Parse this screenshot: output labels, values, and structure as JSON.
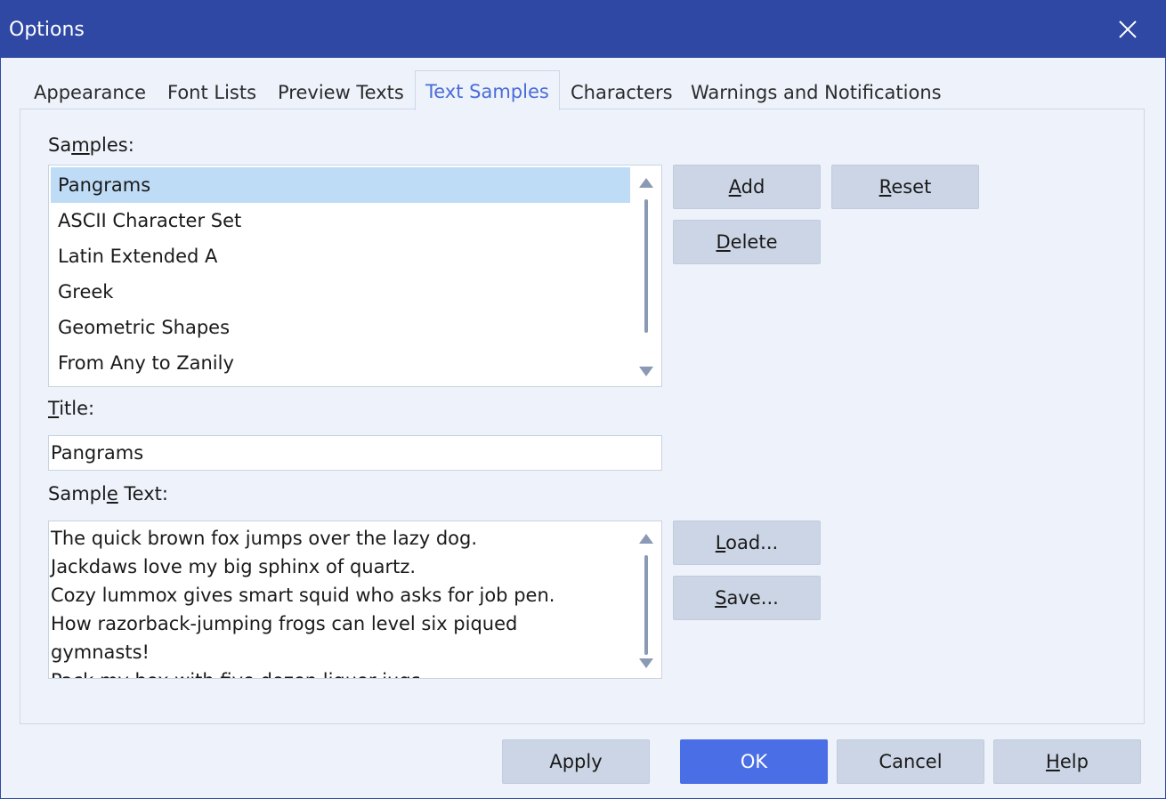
{
  "window": {
    "title": "Options",
    "close_icon": "close-icon"
  },
  "tabs": [
    {
      "label": "Appearance"
    },
    {
      "label": "Font Lists"
    },
    {
      "label": "Preview Texts"
    },
    {
      "label": "Text Samples",
      "active": true
    },
    {
      "label": "Characters"
    },
    {
      "label": "Warnings and Notifications"
    }
  ],
  "samples": {
    "label_pre": "Sa",
    "label_mn": "m",
    "label_post": "ples:",
    "items": [
      "Pangrams",
      "ASCII Character Set",
      "Latin Extended A",
      "Greek",
      "Geometric Shapes",
      "From Any to Zanily"
    ],
    "selected": "Pangrams"
  },
  "title_field": {
    "label_mn": "T",
    "label_post": "itle:",
    "value": "Pangrams"
  },
  "sample_text": {
    "label_pre": "Sampl",
    "label_mn": "e",
    "label_post": " Text:",
    "lines": [
      "The quick brown fox jumps over the lazy dog.",
      "Jackdaws love my big sphinx of quartz.",
      "Cozy lummox gives smart squid who asks for job pen.",
      "How razorback-jumping frogs can level six piqued",
      "gymnasts!",
      "Pack my box with five dozen liquor jugs."
    ]
  },
  "buttons": {
    "add": {
      "mn": "A",
      "rest": "dd"
    },
    "reset": {
      "mn": "R",
      "rest": "eset"
    },
    "delete": {
      "mn": "D",
      "rest": "elete"
    },
    "load": {
      "mn": "L",
      "rest": "oad..."
    },
    "save": {
      "mn": "S",
      "rest": "ave..."
    },
    "apply": "Apply",
    "ok": "OK",
    "cancel": "Cancel",
    "help": {
      "mn": "H",
      "rest": "elp"
    }
  },
  "colors": {
    "titlebar": "#2f48a3",
    "accent": "#4a6ee6",
    "selection": "#bfdcf7",
    "dialog_bg": "#eef3fb"
  }
}
